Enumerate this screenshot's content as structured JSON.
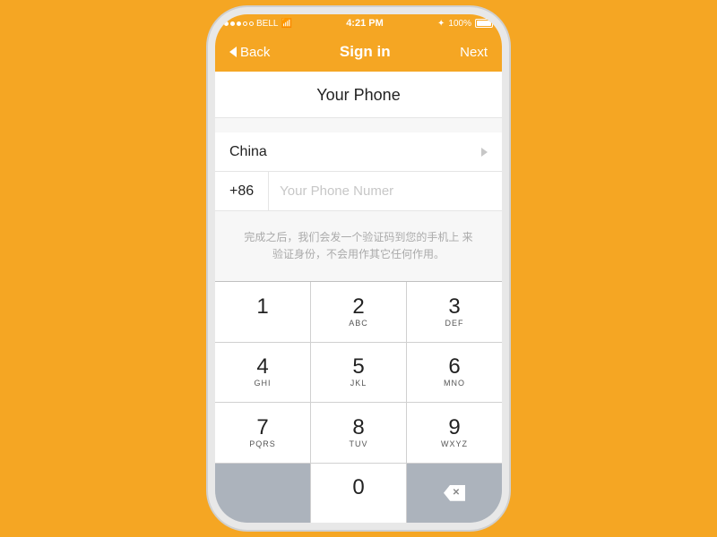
{
  "statusBar": {
    "carrier": "BELL",
    "time": "4:21 PM",
    "battery": "100%"
  },
  "navBar": {
    "backLabel": "Back",
    "title": "Sign in",
    "nextLabel": "Next"
  },
  "phonePage": {
    "title": "Your Phone",
    "countryLabel": "China",
    "countryCode": "+86",
    "phonePlaceholder": "Your Phone Numer",
    "descriptionText": "完成之后，我们会发一个验证码到您的手机上\n来验证身份，不会用作其它任何作用。"
  },
  "keypad": {
    "keys": [
      {
        "number": "1",
        "letters": ""
      },
      {
        "number": "2",
        "letters": "ABC"
      },
      {
        "number": "3",
        "letters": "DEF"
      },
      {
        "number": "4",
        "letters": "GHI"
      },
      {
        "number": "5",
        "letters": "JKL"
      },
      {
        "number": "6",
        "letters": "MNO"
      },
      {
        "number": "7",
        "letters": "PQRS"
      },
      {
        "number": "8",
        "letters": "TUV"
      },
      {
        "number": "9",
        "letters": "WXYZ"
      },
      {
        "number": "",
        "letters": ""
      },
      {
        "number": "0",
        "letters": ""
      },
      {
        "number": "del",
        "letters": ""
      }
    ]
  }
}
